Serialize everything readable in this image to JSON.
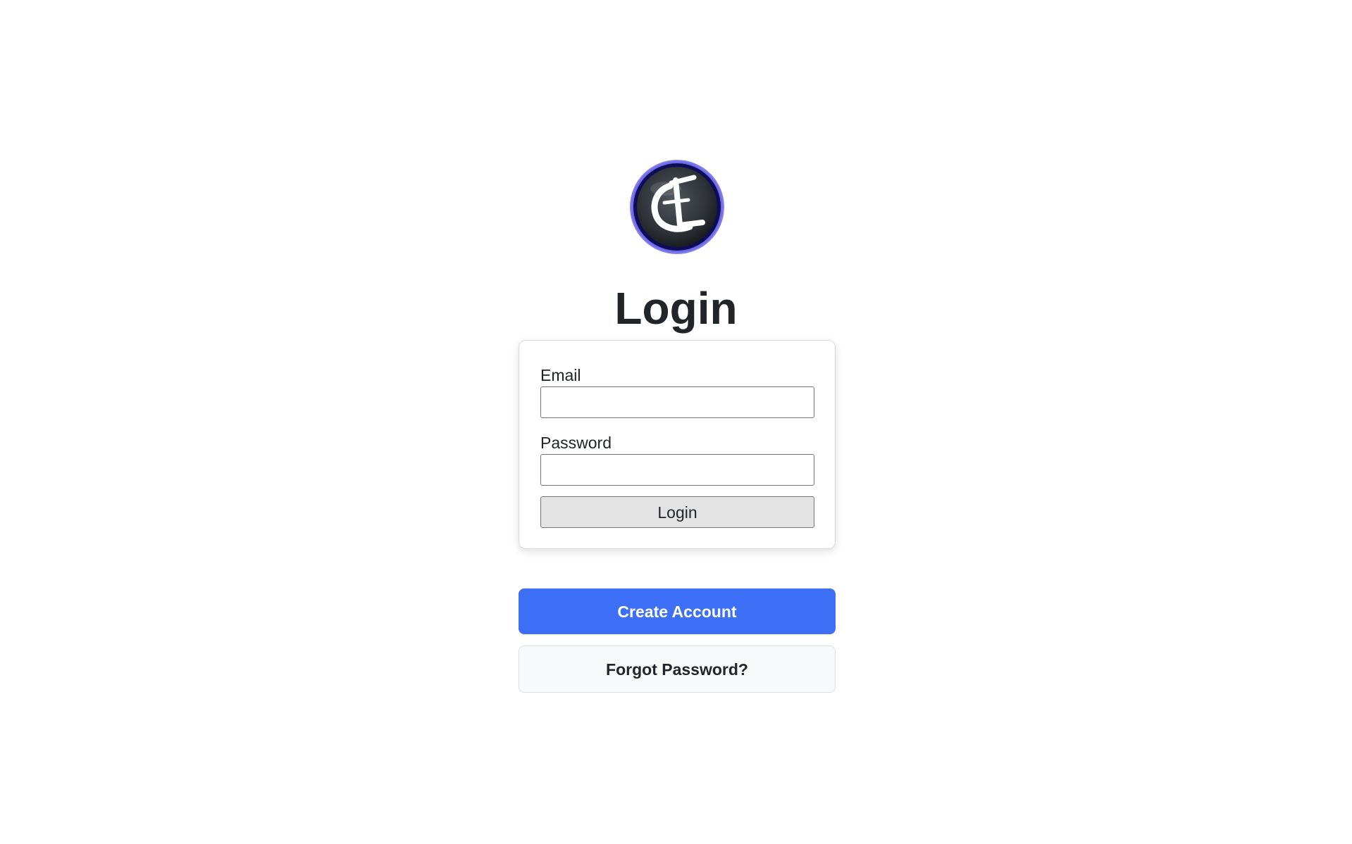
{
  "logo": {
    "icon": "cl-monogram-logo",
    "ring_color": "#2a24c8",
    "face_color": "#2f3338",
    "glyph_color": "#ffffff"
  },
  "page": {
    "title": "Login"
  },
  "login_form": {
    "email_label": "Email",
    "email_value": "",
    "email_placeholder": "",
    "password_label": "Password",
    "password_value": "",
    "password_placeholder": "",
    "submit_label": "Login"
  },
  "actions": {
    "create_account_label": "Create Account",
    "forgot_password_label": "Forgot Password?",
    "primary_color": "#3e6ff7"
  }
}
